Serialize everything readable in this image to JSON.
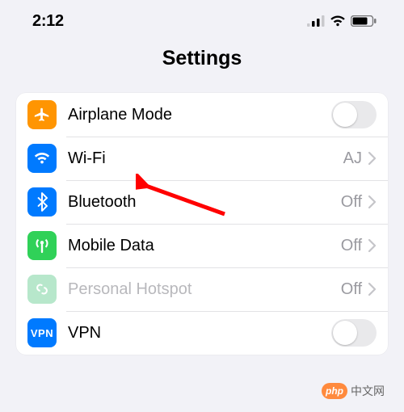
{
  "status": {
    "time": "2:12"
  },
  "header": {
    "title": "Settings"
  },
  "rows": {
    "airplane": {
      "label": "Airplane Mode"
    },
    "wifi": {
      "label": "Wi-Fi",
      "value": "AJ"
    },
    "bluetooth": {
      "label": "Bluetooth",
      "value": "Off"
    },
    "mobile": {
      "label": "Mobile Data",
      "value": "Off"
    },
    "hotspot": {
      "label": "Personal Hotspot",
      "value": "Off"
    },
    "vpn": {
      "label": "VPN",
      "badge": "VPN"
    }
  },
  "watermark": {
    "pill": "php",
    "text": "中文网"
  }
}
